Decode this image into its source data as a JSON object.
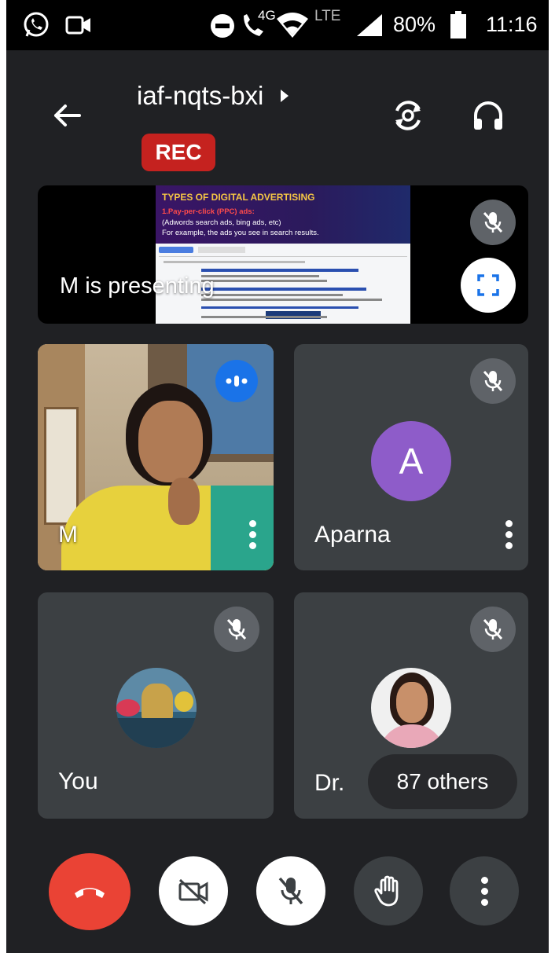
{
  "status_bar": {
    "icons": [
      "whatsapp-icon",
      "video-camera-icon",
      "do-not-disturb-icon",
      "volte-call-icon",
      "wifi-icon",
      "signal-icon",
      "battery-icon"
    ],
    "network_4g": "4G",
    "network_lte": "LTE",
    "battery": "80%",
    "time": "11:16"
  },
  "app_bar": {
    "meeting_code": "iaf-nqts-bxi",
    "rec_label": "REC",
    "rec_color": "#c5221f"
  },
  "presentation": {
    "label": "M is presenting",
    "slide": {
      "title": "TYPES OF DIGITAL ADVERTISING",
      "line1": "1.Pay-per-click (PPC) ads:",
      "line2": "(Adwords search ads, bing ads, etc)",
      "line3": "For example, the ads you see in search results."
    }
  },
  "participants": {
    "m": {
      "name": "M"
    },
    "aparna": {
      "name": "Aparna",
      "initial": "A",
      "avatar_color": "#8e5cc9"
    },
    "you": {
      "name": "You"
    },
    "dr": {
      "name": "Dr.",
      "others": "87 others"
    }
  },
  "colors": {
    "background": "#202124",
    "tile": "#3c4043",
    "end_call": "#ea4335",
    "speaking": "#1a73e8"
  }
}
